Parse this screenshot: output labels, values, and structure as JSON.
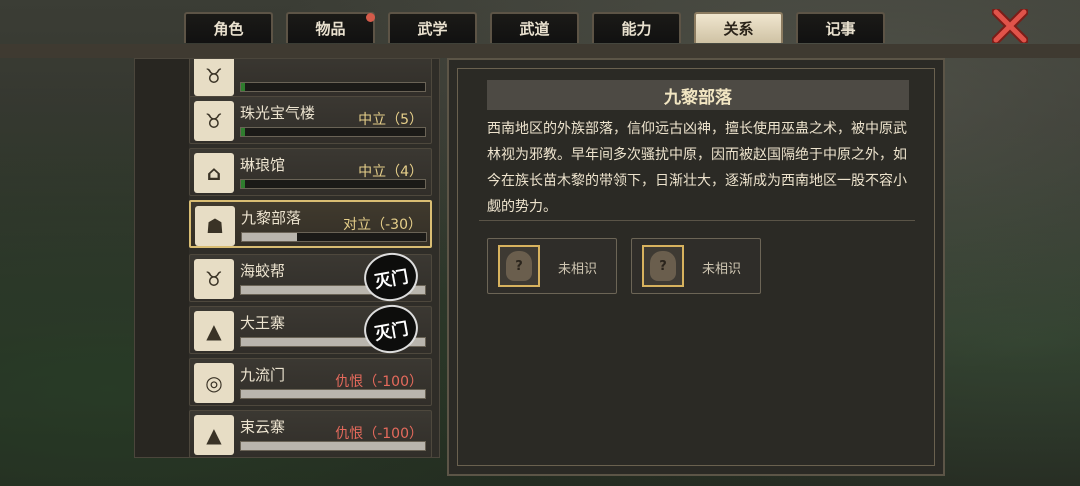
{
  "tabs": [
    {
      "label": "角色",
      "active": false,
      "badge": false
    },
    {
      "label": "物品",
      "active": false,
      "badge": true
    },
    {
      "label": "武学",
      "active": false,
      "badge": false
    },
    {
      "label": "武道",
      "active": false,
      "badge": false
    },
    {
      "label": "能力",
      "active": false,
      "badge": false
    },
    {
      "label": "关系",
      "active": true,
      "badge": false
    },
    {
      "label": "记事",
      "active": false,
      "badge": false
    }
  ],
  "factions": [
    {
      "name": "",
      "status": "",
      "bar_fill": 0.02,
      "bar_color": "#2f7d2e",
      "icon": "ox-head-icon",
      "stamp": ""
    },
    {
      "name": "珠光宝气楼",
      "status": "中立（5）",
      "bar_fill": 0.02,
      "bar_color": "#2f7d2e",
      "icon": "ox-head-icon",
      "stamp": ""
    },
    {
      "name": "琳琅馆",
      "status": "中立（4）",
      "bar_fill": 0.02,
      "bar_color": "#2f7d2e",
      "icon": "pavilion-icon",
      "stamp": ""
    },
    {
      "name": "九黎部落",
      "status": "对立（-30）",
      "bar_fill": 0.3,
      "bar_color": "#b9b5ad",
      "icon": "tribal-mask-icon",
      "stamp": "",
      "selected": true
    },
    {
      "name": "海蛟帮",
      "status": "",
      "bar_fill": 1.0,
      "bar_color": "#b9b5ad",
      "icon": "ox-head-icon",
      "stamp": "灭门"
    },
    {
      "name": "大王寨",
      "status": "",
      "bar_fill": 1.0,
      "bar_color": "#b9b5ad",
      "icon": "mountain-icon",
      "stamp": "灭门"
    },
    {
      "name": "九流门",
      "status": "仇恨（-100）",
      "bar_fill": 1.0,
      "bar_color": "#b9b5ad",
      "icon": "swirl-icon",
      "stamp": "",
      "red": true
    },
    {
      "name": "束云寨",
      "status": "仇恨（-100）",
      "bar_fill": 1.0,
      "bar_color": "#b9b5ad",
      "icon": "mountain-icon",
      "stamp": "",
      "red": true
    }
  ],
  "detail": {
    "title": "九黎部落",
    "description": "西南地区的外族部落，信仰远古凶神，擅长使用巫蛊之术，被中原武林视为邪教。早年间多次骚扰中原，因而被赵国隔绝于中原之外，如今在族长苗木黎的带领下，日渐壮大，逐渐成为西南地区一股不容小觑的势力。",
    "members": [
      {
        "label": "未相识",
        "avatar": "?"
      },
      {
        "label": "未相识",
        "avatar": "?"
      }
    ]
  },
  "colors": {
    "accent": "#d9bd73",
    "neutral": "#e6cf8a",
    "hostile": "#e56a5c",
    "bar_green": "#2f7d2e"
  }
}
